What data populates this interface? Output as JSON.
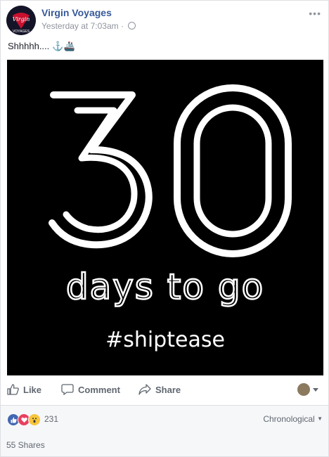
{
  "post": {
    "page_name": "Virgin Voyages",
    "timestamp": "Yesterday at 7:03am",
    "separator": "·",
    "more_label": "•••",
    "caption": "Shhhhh....",
    "caption_emoji": "⚓🚢"
  },
  "hero": {
    "number": "30",
    "tagline": "days to go",
    "hashtag": "#shiptease",
    "background": "#000000",
    "foreground": "#ffffff"
  },
  "avatar": {
    "brand_text": "VOYAGES",
    "accent": "#c8102e"
  },
  "actions": {
    "like_label": "Like",
    "comment_label": "Comment",
    "share_label": "Share"
  },
  "reactions": {
    "types": [
      "like",
      "love",
      "wow"
    ],
    "count": "231",
    "sort_label": "Chronological"
  },
  "shares": {
    "label": "55 Shares"
  },
  "colors": {
    "link_blue": "#365899",
    "meta_gray": "#90949c",
    "action_gray": "#606770",
    "like_blue": "#4267b2",
    "love_red": "#e9405e",
    "wow_yellow": "#f7c53d"
  }
}
